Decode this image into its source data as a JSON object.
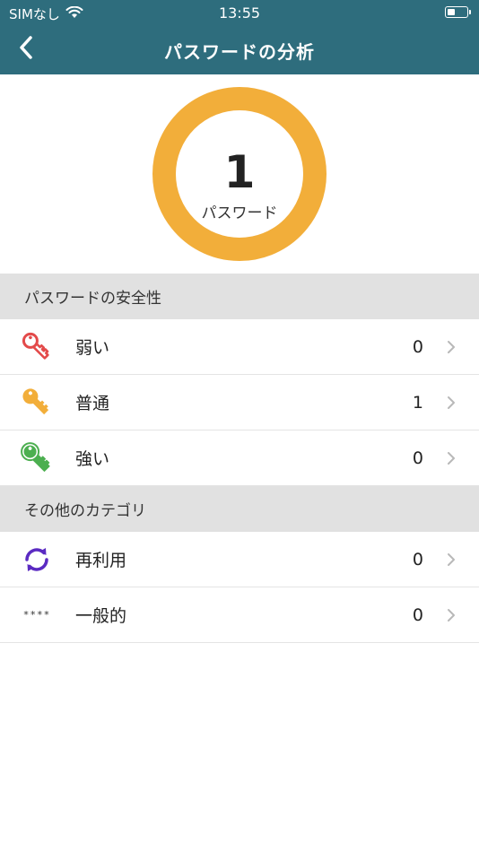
{
  "status_bar": {
    "carrier": "SIMなし",
    "time": "13:55",
    "battery_level": 0.4
  },
  "nav": {
    "title": "パスワードの分析",
    "back_icon": "chevron-left-icon"
  },
  "summary": {
    "count": "1",
    "label": "パスワード",
    "ring_color": "#f2ae3a"
  },
  "security_section": {
    "header": "パスワードの安全性",
    "items": [
      {
        "label": "弱い",
        "count": "0",
        "icon": "key-icon",
        "color": "#e34a4a"
      },
      {
        "label": "普通",
        "count": "1",
        "icon": "key-icon",
        "color": "#f2ae3a"
      },
      {
        "label": "強い",
        "count": "0",
        "icon": "key-icon",
        "color": "#4caf50"
      }
    ]
  },
  "other_section": {
    "header": "その他のカテゴリ",
    "items": [
      {
        "label": "再利用",
        "count": "0",
        "icon": "reuse-icon",
        "color": "#5b2bc2"
      },
      {
        "label": "一般的",
        "count": "0",
        "icon": "masked-password-icon",
        "icon_text": "****"
      }
    ]
  },
  "colors": {
    "header_bg": "#2e6d7d",
    "section_bg": "#e1e1e1"
  }
}
